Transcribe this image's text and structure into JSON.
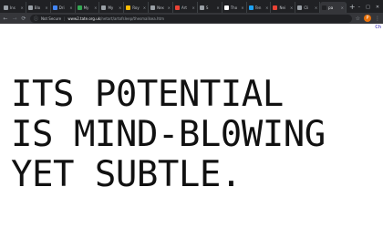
{
  "browser": {
    "tabs": [
      {
        "label": "Ins",
        "color": "#9aa0a6"
      },
      {
        "label": "Blo",
        "color": "#9aa0a6"
      },
      {
        "label": "Dri",
        "color": "#4285f4"
      },
      {
        "label": "My",
        "color": "#34a853"
      },
      {
        "label": "My",
        "color": "#9aa0a6"
      },
      {
        "label": "Roy",
        "color": "#fbbc04"
      },
      {
        "label": "Nex",
        "color": "#9aa0a6"
      },
      {
        "label": "Art",
        "color": "#ea4335"
      },
      {
        "label": "S",
        "color": "#9aa0a6"
      },
      {
        "label": "Tho",
        "color": "#ffffff"
      },
      {
        "label": "Ten",
        "color": "#1da1f2"
      },
      {
        "label": "Nei",
        "color": "#ea4335"
      },
      {
        "label": "Cli",
        "color": "#9aa0a6"
      },
      {
        "label": "pa",
        "color": "#202124",
        "active": true
      }
    ],
    "new_tab": "+",
    "window_controls": [
      "–",
      "□",
      "✕"
    ],
    "back": "←",
    "forward": "→",
    "reload": "⟳",
    "security_label": "Not Secure",
    "url_domain": "www2.tate.org.uk",
    "url_path": "/netart/artofsleep/thesmallsea.htm",
    "star": "☆",
    "avatar_letter": "P",
    "menu": "⋮"
  },
  "page": {
    "corner_link": "Ch",
    "headline": [
      "ITS P0TENTIAL",
      "IS MIND-BL0WING",
      "YET SUBTLE."
    ]
  }
}
